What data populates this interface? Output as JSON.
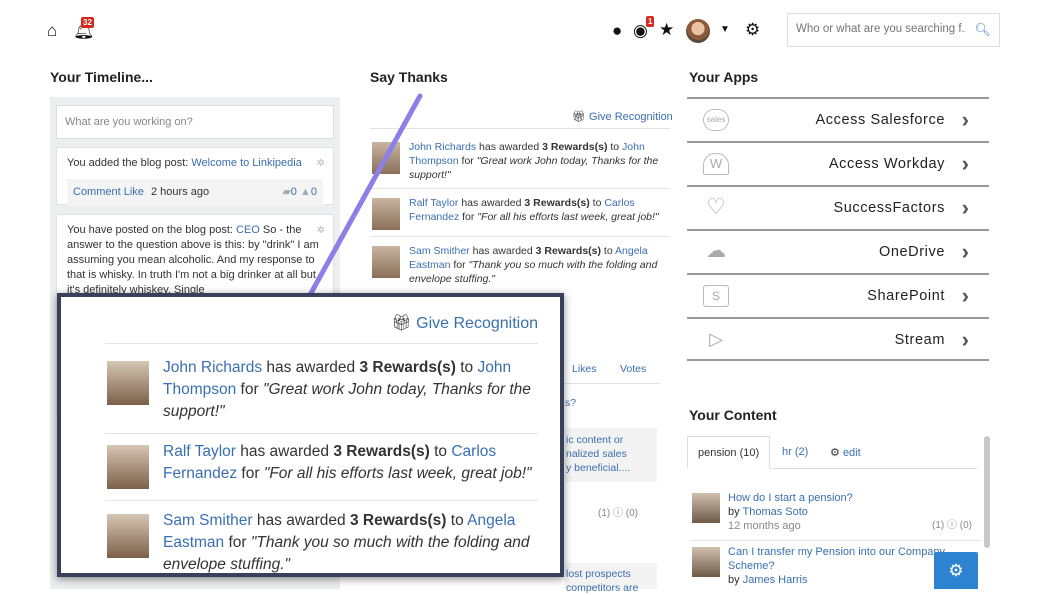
{
  "topbar": {
    "notification_count": "32",
    "alert_count": "1",
    "search_placeholder": "Who or what are you searching f..."
  },
  "timeline": {
    "heading": "Your Timeline...",
    "input_placeholder": "What are you working on?",
    "cards": [
      {
        "prefix": "You added the blog post: ",
        "link": "Welcome to Linkipedia",
        "comment": "Comment",
        "like": "Like",
        "time": "2 hours ago",
        "comments_count": "0",
        "likes_count": "0"
      },
      {
        "prefix": "You have posted on the blog post: ",
        "link": "CEO",
        "body": " So - the answer to the question above is this: by \"drink\" I am assuming you mean alcoholic. And my response to that is whisky. In truth I'm not a big drinker at all but it's definitely whiskey. Single"
      }
    ]
  },
  "thanks": {
    "heading": "Say Thanks",
    "give_recognition": "Give Recognition",
    "items": [
      {
        "from": "John Richards",
        "mid": " has awarded ",
        "reward": "3 Rewards(s)",
        "to_word": " to ",
        "to": "John Thompson",
        "for_word": " for ",
        "quote": "\"Great work John today, Thanks for the support!\""
      },
      {
        "from": "Ralf Taylor",
        "mid": " has awarded ",
        "reward": "3 Rewards(s)",
        "to_word": " to ",
        "to": "Carlos Fernandez",
        "for_word": " for ",
        "quote": "\"For all his efforts last week, great job!\""
      },
      {
        "from": "Sam Smither",
        "mid": " has awarded ",
        "reward": "3 Rewards(s)",
        "to_word": " to ",
        "to": "Angela Eastman",
        "for_word": " for ",
        "quote": "\"Thank you so much with the folding and envelope stuffing.\""
      }
    ],
    "behind": {
      "likes": "Likes",
      "votes": "Votes",
      "q": "s?",
      "content1": "ic content or",
      "content2": "nalized sales",
      "content3": "y beneficial....",
      "counts": "(1) ⓘ (0)",
      "lost1": "lost prospects",
      "lost2": "competitors are"
    }
  },
  "apps": {
    "heading": "Your Apps",
    "items": [
      {
        "name": "Access Salesforce",
        "logo": "salesforce"
      },
      {
        "name": "Access Workday",
        "logo": "W"
      },
      {
        "name": "SuccessFactors",
        "logo": "heart"
      },
      {
        "name": "OneDrive",
        "logo": "cloud"
      },
      {
        "name": "SharePoint",
        "logo": "S"
      },
      {
        "name": "Stream",
        "logo": "play"
      }
    ]
  },
  "content": {
    "heading": "Your Content",
    "tabs": [
      "pension (10)",
      "hr (2)",
      "edit"
    ],
    "items": [
      {
        "title": "How do I start a pension?",
        "by": "by ",
        "author": "Thomas Soto",
        "time": "12 months ago",
        "counts": "(1) ⓘ (0)"
      },
      {
        "title": "Can I transfer my Pension into our Company Scheme?",
        "by": "by ",
        "author": "James Harris"
      }
    ]
  },
  "colors": {
    "link": "#3a6fb0",
    "badge": "#d9281e",
    "fab": "#2e83d1",
    "arrow": "#8c7fe6"
  }
}
